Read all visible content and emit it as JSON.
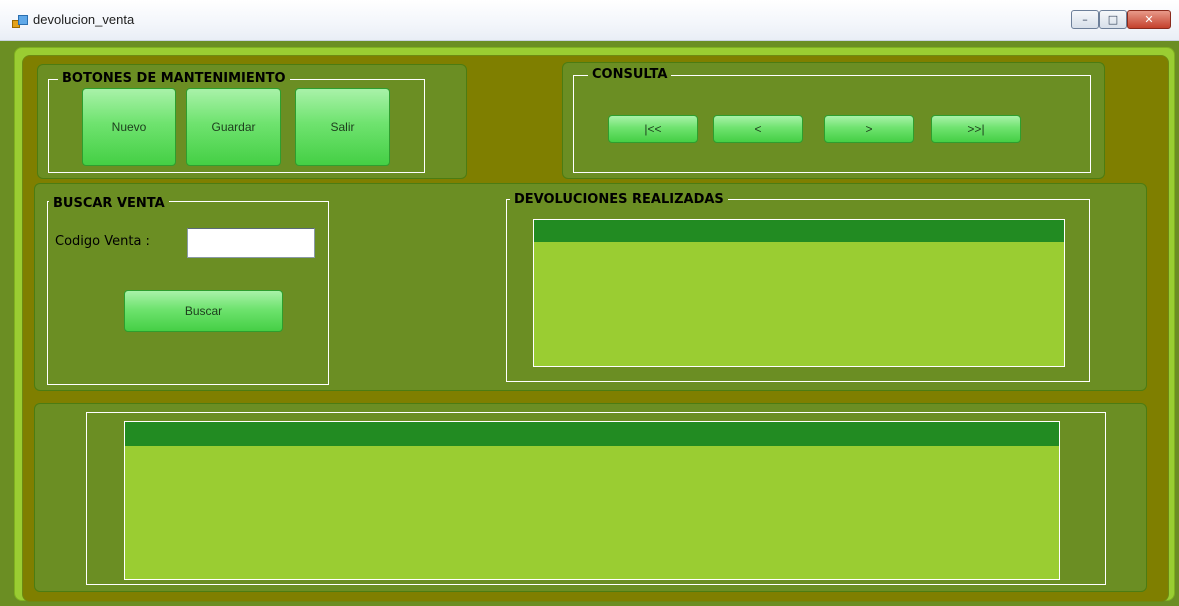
{
  "window": {
    "title": "devolucion_venta",
    "controls": {
      "minimize": "–",
      "maximize": "□",
      "close": "✕"
    },
    "icon": "app-icon"
  },
  "mantenimiento": {
    "title": "BOTONES DE MANTENIMIENTO",
    "buttons": {
      "nuevo": "Nuevo",
      "guardar": "Guardar",
      "salir": "Salir"
    }
  },
  "consulta": {
    "title": "CONSULTA",
    "buttons": {
      "first": "|<<",
      "prev": "<",
      "next": ">",
      "last": ">>|"
    }
  },
  "buscar": {
    "title": "BUSCAR VENTA",
    "codigo_label": "Codigo Venta :",
    "codigo_value": "",
    "buscar_button": "Buscar"
  },
  "devoluciones": {
    "title": "DEVOLUCIONES REALIZADAS"
  },
  "colors": {
    "panel": "#6b8e23",
    "grid_body": "#9acd32",
    "grid_header": "#228b22",
    "frame": "#7f7f00",
    "button": "#6fe36f"
  }
}
